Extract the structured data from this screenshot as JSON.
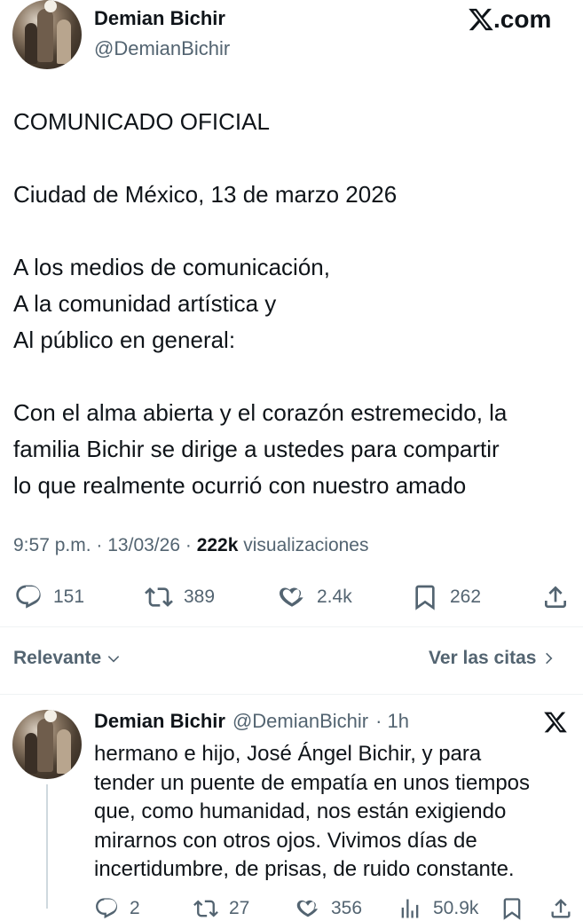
{
  "post": {
    "author_name": "Demian Bichir",
    "author_handle": "@DemianBichir",
    "site_label": "X.com",
    "text": "COMUNICADO OFICIAL\n\nCiudad de México, 13 de marzo 2026\n\nA los medios de comunicación,\nA la comunidad artística y\nAl público en general:\n\nCon el alma abierta y el corazón estremecido, la\nfamilia Bichir se dirige a ustedes para compartir\nlo que realmente ocurrió con nuestro amado",
    "time": "9:57 p.m.",
    "date": "13/03/26",
    "views_count": "222k",
    "views_label": "visualizaciones",
    "separator": "·"
  },
  "actions": {
    "replies": "151",
    "reposts": "389",
    "likes": "2.4k",
    "bookmarks": "262"
  },
  "sort": {
    "label": "Relevante",
    "quotes_label": "Ver las citas"
  },
  "reply": {
    "author_name": "Demian Bichir",
    "author_handle": "@DemianBichir",
    "time_ago": "· 1h",
    "text": "hermano e hijo, José Ángel Bichir, y para\ntender un puente de empatía en unos tiempos\nque, como humanidad, nos están exigiendo\nmirarnos con otros ojos. Vivimos días de\nincertidumbre, de prisas, de ruido constante.",
    "replies": "2",
    "reposts": "27",
    "likes": "356",
    "views": "50.9k"
  },
  "icons": {
    "x_logo": "x-logo-icon",
    "reply": "reply-icon",
    "repost": "repost-icon",
    "like": "heart-icon",
    "bookmark": "bookmark-icon",
    "share": "share-icon",
    "chevron_down": "chevron-down-icon",
    "chevron_right": "chevron-right-icon"
  },
  "colors": {
    "text": "#0f1419",
    "secondary": "#536471",
    "divider": "#eff3f4"
  }
}
